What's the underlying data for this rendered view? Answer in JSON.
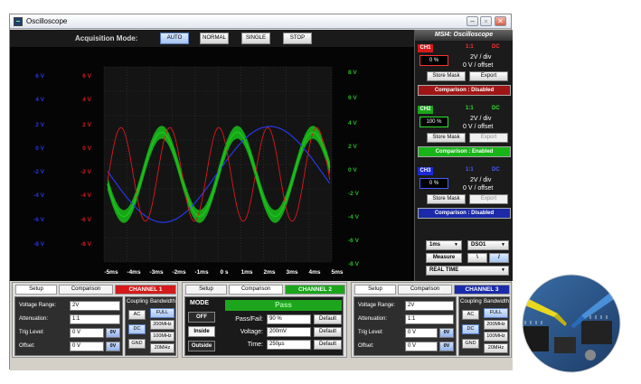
{
  "window": {
    "title": "Oscilloscope",
    "minimize_glyph": "–",
    "restore_glyph": "▫",
    "close_glyph": "✕"
  },
  "acquisition": {
    "label": "Acquisition Mode:",
    "buttons": [
      {
        "label": "AUTO",
        "active": true
      },
      {
        "label": "NORMAL",
        "active": false
      },
      {
        "label": "SINGLE",
        "active": false
      },
      {
        "label": "STOP",
        "active": false
      }
    ]
  },
  "scope": {
    "ch1_ticks": [
      "6 V",
      "4 V",
      "2 V",
      "0 V",
      "-2 V",
      "-4 V",
      "-6 V",
      "-8 V"
    ],
    "ch2_ticks": [
      "8 V",
      "6 V",
      "4 V",
      "2 V",
      "0 V",
      "-2 V",
      "-4 V",
      "-6 V",
      "-8 V"
    ],
    "ch3_ticks": [
      "8 V",
      "6 V",
      "4 V",
      "2 V",
      "0 V",
      "-2 V",
      "-4 V",
      "-6 V",
      "-8 V"
    ],
    "time_ticks": [
      "-5ms",
      "-4ms",
      "-3ms",
      "-2ms",
      "-1ms",
      "0 s",
      "1ms",
      "2ms",
      "3ms",
      "4ms",
      "5ms"
    ],
    "colors": {
      "ch1": "#e01818",
      "ch2": "#1fc01f",
      "ch3": "#2638e8",
      "band": "#16a516"
    }
  },
  "side": {
    "header": "MSI4: Oscilloscope",
    "channels": [
      {
        "tag": "CH1",
        "ratio": "1:1",
        "coupling": "DC",
        "percent": "0 %",
        "div": "2V  / div",
        "offset": "0 V  / offset",
        "store": "Store Mask",
        "export": "Export",
        "status": "Comparison : Disabled",
        "tag_color": "#d41a1a",
        "text_color": "#ff3030",
        "status_color": "#a01616",
        "percent_border": "#ff3030"
      },
      {
        "tag": "CH2",
        "ratio": "1:1",
        "coupling": "DC",
        "percent": "100 %",
        "div": "2V  / div",
        "offset": "0 V  / offset",
        "store": "Store Mask",
        "export": "Export",
        "status": "Comparison : Enabled",
        "tag_color": "#1aa51a",
        "text_color": "#30e030",
        "status_color": "#18b418",
        "percent_border": "#30e030"
      },
      {
        "tag": "CH3",
        "ratio": "1:1",
        "coupling": "DC",
        "percent": "0 %",
        "div": "2V  / div",
        "offset": "0 V  / offset",
        "store": "Store Mask",
        "export": "Export",
        "status": "Comparison : Disabled",
        "tag_color": "#1a2ad4",
        "text_color": "#4a5cff",
        "status_color": "#1a2aa8",
        "percent_border": "#4a5cff"
      }
    ],
    "timebase": "1ms",
    "source": "DSO1",
    "measure": "Measure",
    "edge_fall": "\\",
    "edge_rise": "/",
    "run_mode": "REAL TIME",
    "dropdown_glyph": "▼"
  },
  "bottom": {
    "ch1": {
      "tabs": [
        "Setup",
        "Comparison",
        "CHANNEL 1"
      ],
      "voltage_label": "Voltage Range:",
      "voltage_value": "2V",
      "atten_label": "Attenuation:",
      "atten_value": "1:1",
      "trig_label": "Trig Level:",
      "trig_value": "0 V",
      "trig_btn": "0V",
      "offset_label": "Offset:",
      "offset_value": "0 V",
      "offset_btn": "0V",
      "coupling_header": "Coupling",
      "bandwidth_header": "Bandwidth",
      "coupling": [
        "AC",
        "DC",
        "GND"
      ],
      "coupling_active": 1,
      "bandwidth": [
        "FULL",
        "200MHz",
        "100MHz",
        "20MHz"
      ],
      "bandwidth_active": 0,
      "color": "#d41a1a"
    },
    "ch2": {
      "tabs": [
        "Setup",
        "Comparison",
        "CHANNEL 2"
      ],
      "mode_title": "MODE",
      "modes": [
        "OFF",
        "Inside",
        "Outside"
      ],
      "mode_active": 1,
      "pass_text": "Pass",
      "passfail_label": "Pass/Fail:",
      "passfail_value": "90 %",
      "voltage_label": "Voltage:",
      "voltage_value": "200mV",
      "time_label": "Time:",
      "time_value": "250µs",
      "default_label": "Default",
      "color": "#1aa51a"
    },
    "ch3": {
      "tabs": [
        "Setup",
        "Comparison",
        "CHANNEL 3"
      ],
      "voltage_label": "Voltage Range:",
      "voltage_value": "2V",
      "atten_label": "Attenuation:",
      "atten_value": "1:1",
      "trig_label": "Trig Level:",
      "trig_value": "0 V",
      "trig_btn": "0V",
      "offset_label": "Offset:",
      "offset_value": "0 V",
      "offset_btn": "0V",
      "coupling_header": "Coupling",
      "bandwidth_header": "Bandwidth",
      "coupling": [
        "AC",
        "DC",
        "GND"
      ],
      "coupling_active": 1,
      "bandwidth": [
        "FULL",
        "200MHz",
        "100MHz",
        "20MHz"
      ],
      "bandwidth_active": 0,
      "color": "#1a2aa8"
    }
  }
}
